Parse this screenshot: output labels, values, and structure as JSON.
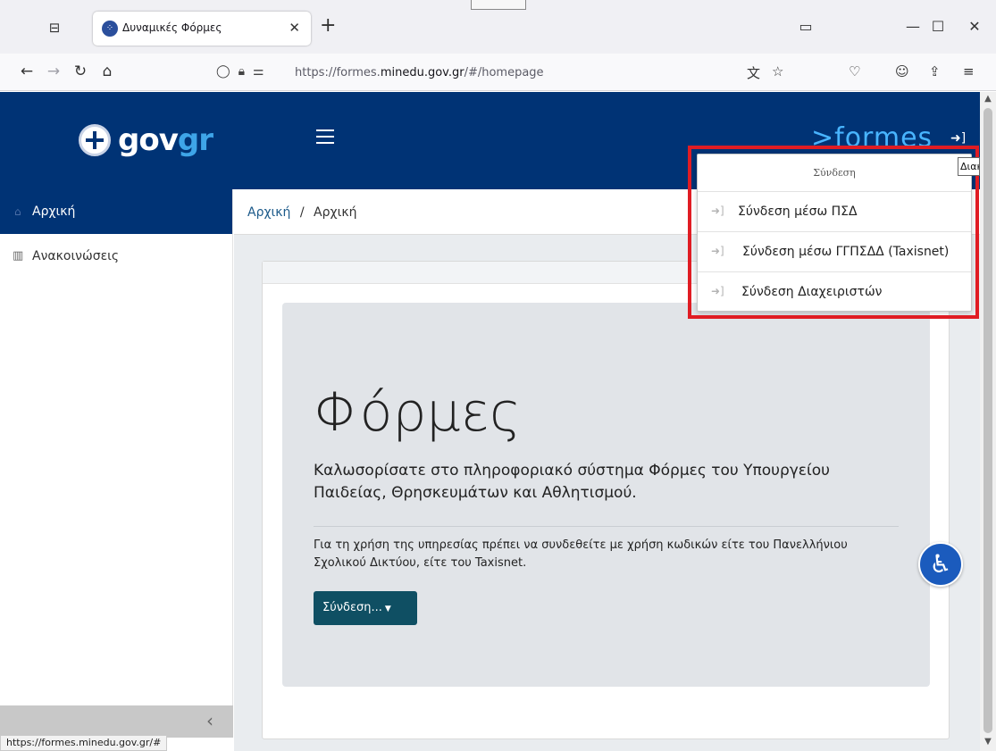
{
  "browser": {
    "tab_title": "Δυναμικές Φόρμες",
    "new_tab": "+",
    "url_prefix": "https://formes.",
    "url_domain": "minedu.gov.gr",
    "url_suffix": "/#/homepage",
    "status_url": "https://formes.minedu.gov.gr/#"
  },
  "header": {
    "logo_part1": "gov",
    "logo_part2": "gr",
    "brand": ">formes"
  },
  "sidebar": {
    "items": [
      {
        "label": "Αρχική",
        "icon": "home-icon",
        "active": true
      },
      {
        "label": "Ανακοινώσεις",
        "icon": "book-icon",
        "active": false
      }
    ]
  },
  "breadcrumb": {
    "link": "Αρχική",
    "separator": "/",
    "current": "Αρχική"
  },
  "jumbotron": {
    "title": "Φόρμες",
    "lead": "Καλωσορίσατε στο πληροφοριακό σύστημα Φόρμες του Υπουργείου Παιδείας, Θρησκευμάτων και Αθλητισμού.",
    "text": "Για τη χρήση της υπηρεσίας πρέπει να συνδεθείτε με χρήση κωδικών είτε του Πανελλήνιου Σχολικού Δικτύου, είτε του Taxisnet.",
    "button": "Σύνδεση..."
  },
  "login_menu": {
    "header": "Σύνδεση",
    "items": [
      "Σύνδεση μέσω ΠΣΔ",
      "Σύνδεση μέσω ΓΓΠΣΔΔ (Taxisnet)",
      "Σύνδεση Διαχειριστών"
    ]
  },
  "tooltip": "Διακόπτης",
  "colors": {
    "header_bg": "#003375",
    "highlight": "#e01c23",
    "button_bg": "#0f4f63",
    "accessibility": "#1b5bbd"
  }
}
